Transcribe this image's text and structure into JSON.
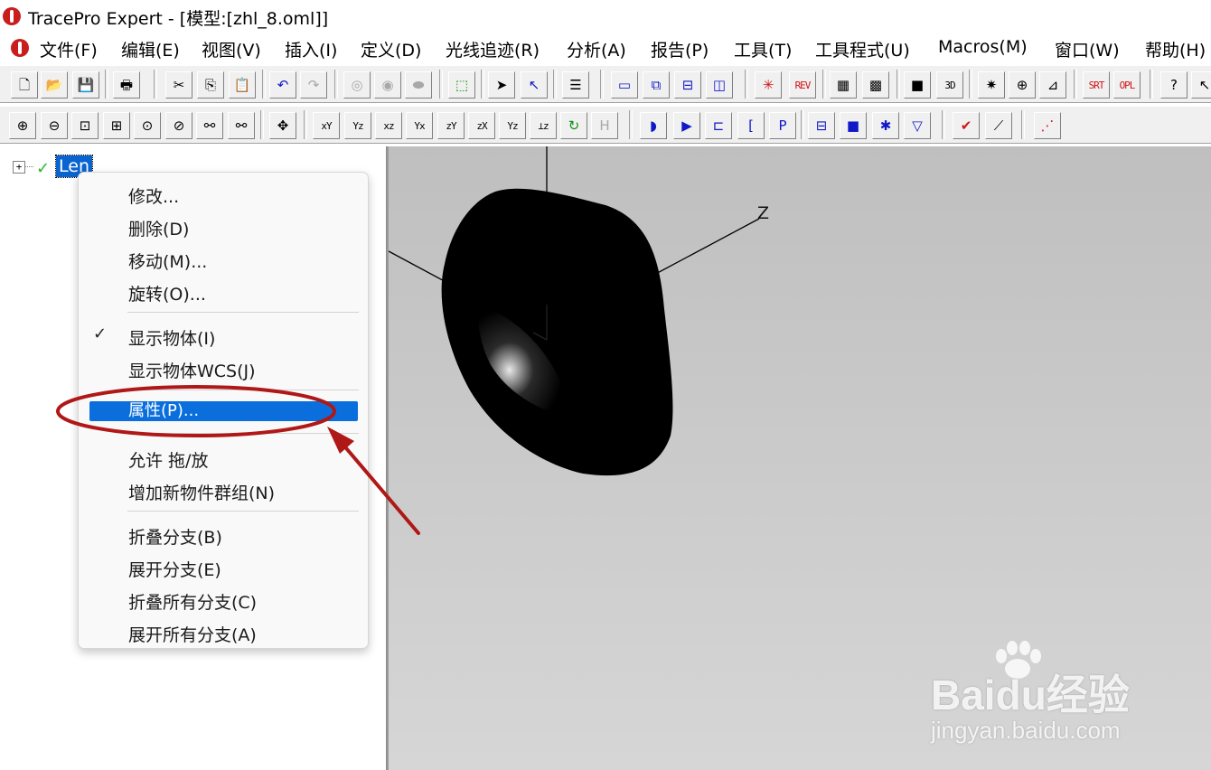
{
  "window": {
    "title": "TracePro Expert - [模型:[zhl_8.oml]]"
  },
  "menu": [
    "文件(F)",
    "编辑(E)",
    "视图(V)",
    "插入(I)",
    "定义(D)",
    "光线追迹(R)",
    "分析(A)",
    "报告(P)",
    "工具(T)",
    "工具程式(U)",
    "Macros(M)",
    "窗口(W)",
    "帮助(H)"
  ],
  "toolbar1": {
    "buttons": [
      {
        "name": "new-file-icon",
        "glyph": "🗋"
      },
      {
        "name": "open-file-icon",
        "glyph": "📂"
      },
      {
        "name": "save-icon",
        "glyph": "💾"
      },
      {
        "name": "print-icon",
        "glyph": "🖶"
      },
      {
        "name": "cut-icon",
        "glyph": "✂"
      },
      {
        "name": "copy-icon",
        "glyph": "⎘"
      },
      {
        "name": "paste-icon",
        "glyph": "📋"
      },
      {
        "name": "undo-icon",
        "glyph": "↶"
      },
      {
        "name": "redo-icon",
        "glyph": "↷"
      },
      {
        "name": "boolean-union-icon",
        "glyph": "◎"
      },
      {
        "name": "boolean-intersect-icon",
        "glyph": "◉"
      },
      {
        "name": "boolean-subtract-icon",
        "glyph": "⬬"
      },
      {
        "name": "solid-model-icon",
        "glyph": "⬚"
      },
      {
        "name": "select-arrow-icon",
        "glyph": "➤"
      },
      {
        "name": "select-object-icon",
        "glyph": "↖"
      },
      {
        "name": "notes-icon",
        "glyph": "☰"
      },
      {
        "name": "window-single-icon",
        "glyph": "▭"
      },
      {
        "name": "window-cascade-icon",
        "glyph": "⧉"
      },
      {
        "name": "window-tile-horizontal-icon",
        "glyph": "⊟"
      },
      {
        "name": "window-tile-vertical-icon",
        "glyph": "◫"
      },
      {
        "name": "ray-source-icon",
        "glyph": "✳"
      },
      {
        "name": "rev-icon",
        "glyph": "REV"
      },
      {
        "name": "grid-map-icon",
        "glyph": "▦"
      },
      {
        "name": "irradiance-map-icon",
        "glyph": "▩"
      },
      {
        "name": "color-map-icon",
        "glyph": "■"
      },
      {
        "name": "3d-view-icon",
        "glyph": "3D"
      },
      {
        "name": "candela-icon",
        "glyph": "✷"
      },
      {
        "name": "polar-plot-icon",
        "glyph": "⊕"
      },
      {
        "name": "chart-icon",
        "glyph": "⊿"
      },
      {
        "name": "srt-icon",
        "glyph": "SRT"
      },
      {
        "name": "opl-icon",
        "glyph": "OPL"
      },
      {
        "name": "help-icon",
        "glyph": "?"
      },
      {
        "name": "context-help-icon",
        "glyph": "↖"
      }
    ]
  },
  "toolbar2": {
    "buttons": [
      {
        "name": "zoom-in-icon",
        "glyph": "⊕"
      },
      {
        "name": "zoom-out-icon",
        "glyph": "⊖"
      },
      {
        "name": "zoom-window-icon",
        "glyph": "⊡"
      },
      {
        "name": "zoom-all-icon",
        "glyph": "⊞"
      },
      {
        "name": "zoom-selected-icon",
        "glyph": "⊙"
      },
      {
        "name": "zoom-previous-icon",
        "glyph": "⊘"
      },
      {
        "name": "view-eye-icon",
        "glyph": "⚯"
      },
      {
        "name": "view-eye-alt-icon",
        "glyph": "⚯"
      },
      {
        "name": "pan-icon",
        "glyph": "✥"
      },
      {
        "name": "view-xy-icon",
        "glyph": "xY"
      },
      {
        "name": "view-yz-icon",
        "glyph": "Yz"
      },
      {
        "name": "view-xz-icon",
        "glyph": "xz"
      },
      {
        "name": "view-yx-icon",
        "glyph": "Yx"
      },
      {
        "name": "view-zy-icon",
        "glyph": "zY"
      },
      {
        "name": "view-zx-icon",
        "glyph": "zX"
      },
      {
        "name": "view-iso-icon",
        "glyph": "Yz"
      },
      {
        "name": "view-axes-icon",
        "glyph": "⊥z"
      },
      {
        "name": "rotate-icon",
        "glyph": "↻"
      },
      {
        "name": "h-icon",
        "glyph": "H"
      },
      {
        "name": "lens-icon",
        "glyph": "◗"
      },
      {
        "name": "prism-icon",
        "glyph": "▶"
      },
      {
        "name": "reflector-icon",
        "glyph": "⊏"
      },
      {
        "name": "bracket-icon",
        "glyph": "["
      },
      {
        "name": "p-icon",
        "glyph": "P"
      },
      {
        "name": "block-icon",
        "glyph": "⊟"
      },
      {
        "name": "square-icon",
        "glyph": "■"
      },
      {
        "name": "surface-icon",
        "glyph": "✱"
      },
      {
        "name": "cone-icon",
        "glyph": "▽"
      },
      {
        "name": "check-icon",
        "glyph": "✔"
      },
      {
        "name": "ruler-icon",
        "glyph": "⟋"
      },
      {
        "name": "ray-plot-icon",
        "glyph": "⋰"
      }
    ]
  },
  "tree": {
    "root_label": "Len"
  },
  "context_menu": {
    "items": [
      "修改...",
      "删除(D)",
      "移动(M)...",
      "旋转(O)...",
      "显示物体(I)",
      "显示物体WCS(J)",
      "属性(P)...",
      "允许 拖/放",
      "增加新物件群组(N)",
      "折叠分支(B)",
      "展开分支(E)",
      "折叠所有分支(C)",
      "展开所有分支(A)"
    ],
    "checked_item": "显示物体(I)",
    "highlighted_item": "属性(P)..."
  },
  "viewport": {
    "axis_label": "Z"
  },
  "watermark": {
    "brand": "Bai",
    "brand_cn": "经验",
    "url": "jingyan.baidu.com"
  },
  "colors": {
    "selection": "#0a64d0",
    "annotation": "#b01818",
    "check": "#2bb52b"
  }
}
